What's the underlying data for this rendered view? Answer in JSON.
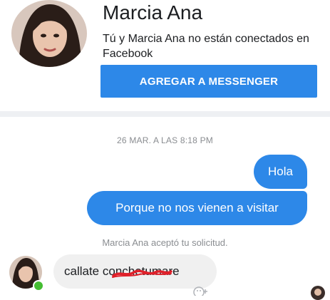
{
  "contact": {
    "name": "Marcia Ana",
    "connection_status": "Tú y Marcia Ana no están conectados en Facebook",
    "add_button_label": "AGREGAR A MESSENGER"
  },
  "conversation": {
    "timestamp": "26 MAR. A LAS 8:18 PM",
    "outgoing_messages": [
      "Hola",
      "Porque no nos vienen a visitar"
    ],
    "system_notice": "Marcia Ana aceptó tu solicitud.",
    "incoming_message": "callate conchetumare"
  },
  "colors": {
    "accent": "#2d88e8",
    "incoming_bubble": "#f0f0f0",
    "online": "#44bd32",
    "scribble": "#e0202a"
  },
  "icons": {
    "reaction": "emoji-plus-icon"
  }
}
